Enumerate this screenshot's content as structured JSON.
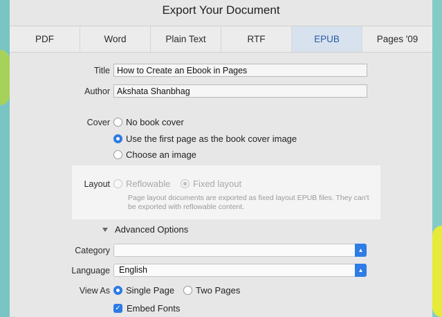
{
  "dialog": {
    "title": "Export Your Document"
  },
  "tabs": [
    {
      "label": "PDF"
    },
    {
      "label": "Word"
    },
    {
      "label": "Plain Text"
    },
    {
      "label": "RTF"
    },
    {
      "label": "EPUB"
    },
    {
      "label": "Pages '09"
    }
  ],
  "form": {
    "title_label": "Title",
    "title_value": "How to Create an Ebook in Pages",
    "author_label": "Author",
    "author_value": "Akshata Shanbhag",
    "cover_label": "Cover",
    "cover_options": [
      {
        "label": "No book cover"
      },
      {
        "label": "Use the first page as the book cover image"
      },
      {
        "label": "Choose an image"
      }
    ],
    "layout_label": "Layout",
    "layout_options": [
      {
        "label": "Reflowable"
      },
      {
        "label": "Fixed layout"
      }
    ],
    "layout_note": "Page layout documents are exported as fixed layout EPUB files. They can't be exported with reflowable content.",
    "advanced_label": "Advanced Options",
    "category_label": "Category",
    "category_value": "",
    "language_label": "Language",
    "language_value": "English",
    "viewas_label": "View As",
    "viewas_options": [
      {
        "label": "Single Page"
      },
      {
        "label": "Two Pages"
      }
    ],
    "embed_fonts_label": "Embed Fonts"
  },
  "colors": {
    "accent": "#2c7be5",
    "active_tab": "#d7e2ee"
  }
}
